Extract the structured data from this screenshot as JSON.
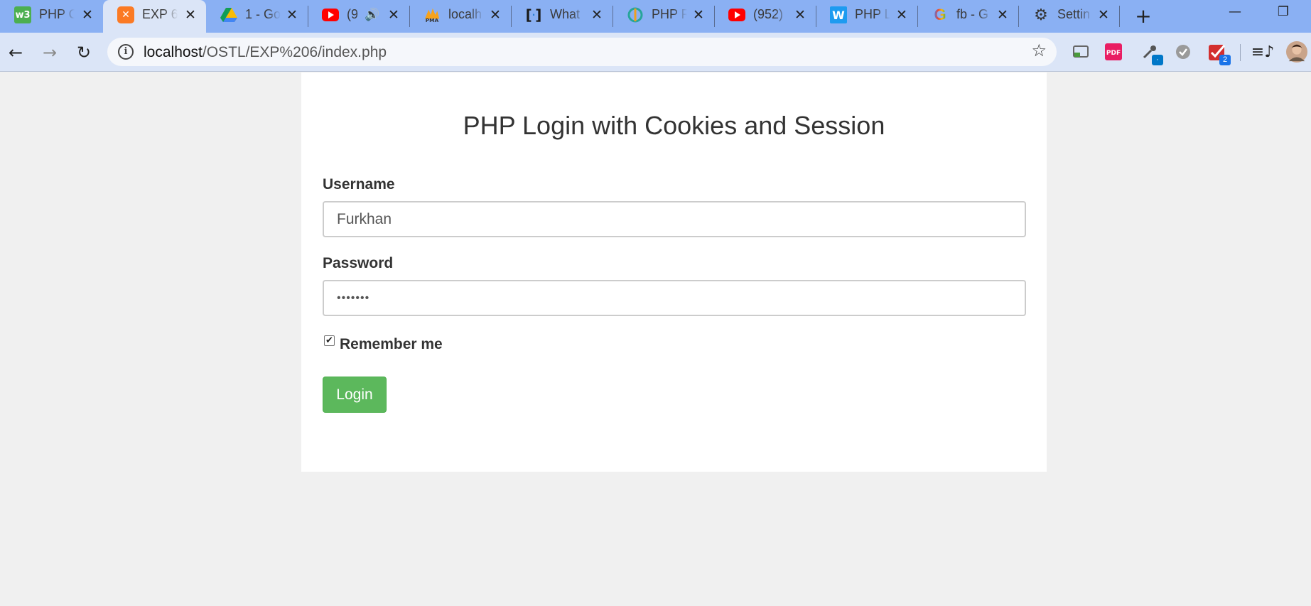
{
  "browser": {
    "tabs": [
      {
        "title": "PHP C",
        "icon": "w3schools-icon",
        "active": false
      },
      {
        "title": "EXP 6",
        "icon": "xampp-icon",
        "active": true
      },
      {
        "title": "1 - Go",
        "icon": "google-drive-icon",
        "active": false
      },
      {
        "title": "(9",
        "icon": "youtube-icon",
        "active": false
      },
      {
        "title": "localh",
        "icon": "phpmyadmin-icon",
        "active": false
      },
      {
        "title": "What",
        "icon": "brackets-icon",
        "active": false
      },
      {
        "title": "PHP R",
        "icon": "tab-logo-icon",
        "active": false
      },
      {
        "title": "(952)",
        "icon": "youtube-icon",
        "active": false
      },
      {
        "title": "PHP L",
        "icon": "w-logo-icon",
        "active": false
      },
      {
        "title": "fb - G",
        "icon": "google-icon",
        "active": false
      },
      {
        "title": "Settin",
        "icon": "gear-icon",
        "active": false
      }
    ],
    "url_host": "localhost",
    "url_path": "/OSTL/EXP%206/index.php",
    "extension_badge": "2"
  },
  "form": {
    "title": "PHP Login with Cookies and Session",
    "username_label": "Username",
    "username_value": "Furkhan",
    "password_label": "Password",
    "password_value": "•••••••",
    "remember_label": "Remember me",
    "remember_checked": true,
    "login_label": "Login"
  },
  "colors": {
    "tab_strip": "#8ab0f3",
    "toolbar": "#dbe5f7",
    "page_background": "#f0f0f0",
    "login_button": "#5cb85c"
  }
}
